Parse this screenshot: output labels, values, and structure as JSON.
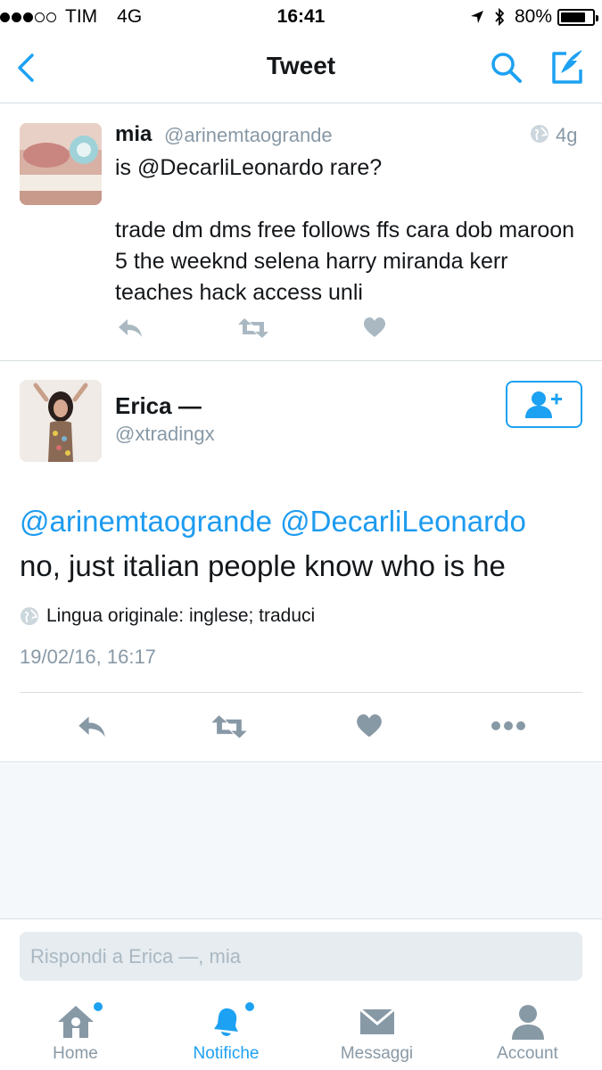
{
  "status_bar": {
    "carrier": "TIM",
    "network": "4G",
    "time": "16:41",
    "battery": "80%",
    "battery_level": 0.8
  },
  "nav": {
    "title": "Tweet",
    "back_icon": "chevron-left-icon",
    "search_icon": "search-icon",
    "compose_icon": "compose-icon",
    "accent_color": "#1da1f2"
  },
  "parent_tweet": {
    "name": "mia",
    "handle": "@arinemtaogrande",
    "time": "4g",
    "text": "is @DecarliLeonardo rare?\n\ntrade dm dms free follows ffs cara dob maroon 5 the weeknd selena harry miranda kerr teaches hack access unli"
  },
  "tweet": {
    "name": "Erica —",
    "handle": "@xtradingx",
    "mention1": "@arinemtaogrande",
    "mention2": "@DecarliLeonardo",
    "body": "no, just italian people know who is he",
    "translate": "Lingua originale: inglese; traduci",
    "date": "19/02/16, 16:17"
  },
  "reply": {
    "placeholder": "Rispondi a Erica —, mia"
  },
  "tabs": [
    {
      "label": "Home",
      "icon": "home-icon",
      "active": false,
      "badge": true
    },
    {
      "label": "Notifiche",
      "icon": "bell-icon",
      "active": true,
      "badge": true
    },
    {
      "label": "Messaggi",
      "icon": "envelope-icon",
      "active": false,
      "badge": false
    },
    {
      "label": "Account",
      "icon": "person-icon",
      "active": false,
      "badge": false
    }
  ]
}
